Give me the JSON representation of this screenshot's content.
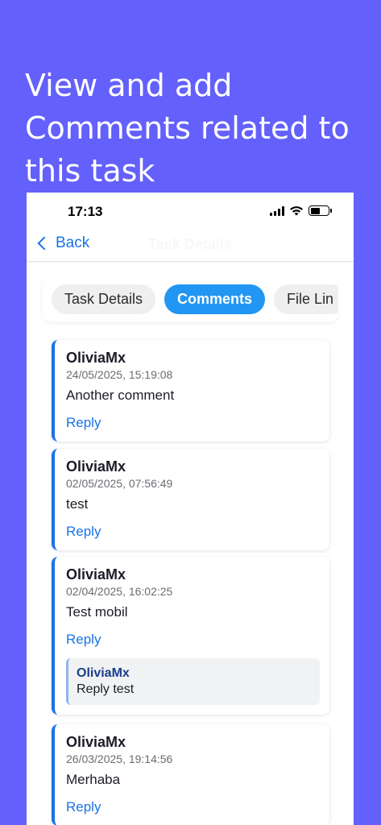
{
  "headline": "View and add Comments related to this task",
  "status_bar": {
    "time": "17:13"
  },
  "nav": {
    "back_label": "Back",
    "title": "Task Details"
  },
  "tabs": [
    {
      "label": "Task Details",
      "active": false
    },
    {
      "label": "Comments",
      "active": true
    },
    {
      "label": "File Lin",
      "active": false
    }
  ],
  "comments": [
    {
      "author": "OliviaMx",
      "date": "24/05/2025, 15:19:08",
      "text": "Another comment",
      "reply_label": "Reply"
    },
    {
      "author": "OliviaMx",
      "date": "02/05/2025, 07:56:49",
      "text": "test",
      "reply_label": "Reply"
    },
    {
      "author": "OliviaMx",
      "date": "02/04/2025, 16:02:25",
      "text": "Test mobil",
      "reply_label": "Reply",
      "replies": [
        {
          "author": "OliviaMx",
          "text": "Reply test"
        }
      ]
    },
    {
      "author": "OliviaMx",
      "date": "26/03/2025, 19:14:56",
      "text": "Merhaba",
      "reply_label": "Reply"
    }
  ],
  "colors": {
    "background": "#6360fb",
    "accent": "#1a73e8",
    "active_tab": "#2196f3"
  }
}
